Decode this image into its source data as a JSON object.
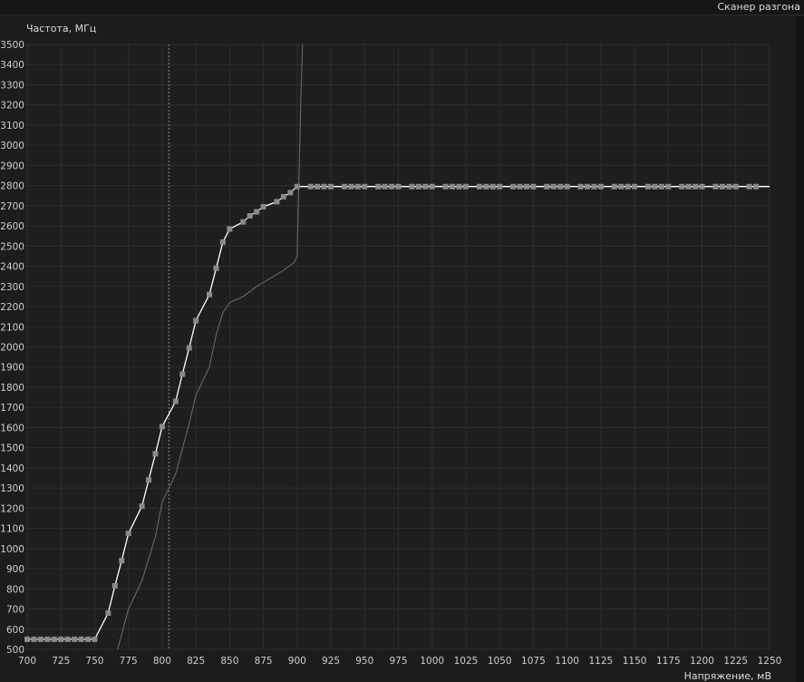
{
  "window": {
    "title": "Сканер разгона"
  },
  "chart_data": {
    "type": "line",
    "xlabel": "Напряжение, мВ",
    "ylabel": "Частота, МГц",
    "xlim": [
      700,
      1250
    ],
    "ylim": [
      500,
      3500
    ],
    "x_ticks": [
      700,
      725,
      750,
      775,
      800,
      825,
      850,
      875,
      900,
      925,
      950,
      975,
      1000,
      1025,
      1050,
      1075,
      1100,
      1125,
      1150,
      1175,
      1200,
      1225,
      1250
    ],
    "y_ticks": [
      500,
      600,
      700,
      800,
      900,
      1000,
      1100,
      1200,
      1300,
      1400,
      1500,
      1600,
      1700,
      1800,
      1900,
      2000,
      2100,
      2200,
      2300,
      2400,
      2500,
      2600,
      2700,
      2800,
      2900,
      3000,
      3100,
      3200,
      3300,
      3400,
      3500
    ],
    "grid": true,
    "marker_vline": 805,
    "series": [
      {
        "color": "#ffffff",
        "markers": true,
        "x": [
          700,
          705,
          710,
          715,
          720,
          725,
          730,
          735,
          740,
          745,
          750,
          760,
          765,
          770,
          775,
          785,
          790,
          795,
          800,
          810,
          815,
          820,
          825,
          835,
          840,
          845,
          850,
          860,
          865,
          870,
          875,
          885,
          890,
          895,
          900,
          910,
          915,
          920,
          925,
          935,
          940,
          945,
          950,
          960,
          965,
          970,
          975,
          985,
          990,
          995,
          1000,
          1010,
          1015,
          1020,
          1025,
          1035,
          1040,
          1045,
          1050,
          1060,
          1065,
          1070,
          1075,
          1085,
          1090,
          1095,
          1100,
          1110,
          1115,
          1120,
          1125,
          1135,
          1140,
          1145,
          1150,
          1160,
          1165,
          1170,
          1175,
          1185,
          1190,
          1195,
          1200,
          1210,
          1215,
          1220,
          1225,
          1235,
          1240
        ],
        "y": [
          550,
          550,
          550,
          550,
          550,
          550,
          550,
          550,
          550,
          550,
          550,
          680,
          815,
          940,
          1075,
          1210,
          1340,
          1470,
          1605,
          1730,
          1865,
          1995,
          2130,
          2260,
          2390,
          2520,
          2585,
          2620,
          2650,
          2670,
          2695,
          2720,
          2745,
          2765,
          2795,
          2795,
          2795,
          2795,
          2795,
          2795,
          2795,
          2795,
          2795,
          2795,
          2795,
          2795,
          2795,
          2795,
          2795,
          2795,
          2795,
          2795,
          2795,
          2795,
          2795,
          2795,
          2795,
          2795,
          2795,
          2795,
          2795,
          2795,
          2795,
          2795,
          2795,
          2795,
          2795,
          2795,
          2795,
          2795,
          2795,
          2795,
          2795,
          2795,
          2795,
          2795,
          2795,
          2795,
          2795,
          2795,
          2795,
          2795,
          2795,
          2795,
          2795,
          2795,
          2795,
          2795,
          2795
        ],
        "line_extends_to_x": 1250
      },
      {
        "color": "#6e6e6e",
        "markers": false,
        "x": [
          767,
          775,
          785,
          795,
          800,
          805,
          810,
          820,
          825,
          835,
          840,
          845,
          850,
          860,
          870,
          880,
          890,
          898,
          900,
          903,
          904
        ],
        "y": [
          500,
          700,
          840,
          1060,
          1230,
          1300,
          1370,
          1620,
          1760,
          1900,
          2060,
          2170,
          2220,
          2250,
          2300,
          2340,
          2380,
          2420,
          2450,
          3300,
          3500
        ]
      }
    ]
  }
}
